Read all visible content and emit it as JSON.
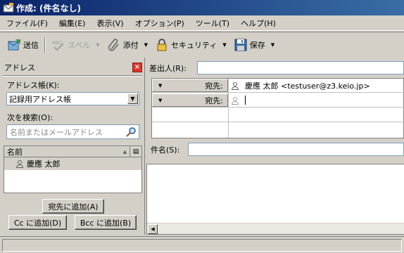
{
  "window": {
    "title": "作成: (件名なし)"
  },
  "menu": [
    "ファイル(F)",
    "編集(E)",
    "表示(V)",
    "オプション(P)",
    "ツール(T)",
    "ヘルプ(H)"
  ],
  "toolbar": {
    "send": "送信",
    "spell": "スペル",
    "attach": "添付",
    "security": "セキュリティ",
    "save": "保存"
  },
  "sidebar": {
    "title": "アドレス",
    "addressbook_label": "アドレス帳(K):",
    "addressbook_value": "記録用アドレス帳",
    "search_label": "次を検索(O):",
    "search_placeholder": "名前またはメールアドレス",
    "column_name": "名前",
    "contacts": [
      "慶應 太郎"
    ],
    "add_to_button": "宛先に追加(A)",
    "add_cc_button": "Cc に追加(D)",
    "add_bcc_button": "Bcc に追加(B)"
  },
  "compose": {
    "from_label": "差出人(R):",
    "from_value": "",
    "recipients": [
      {
        "type": "宛先:",
        "value": "慶應 太郎 <testuser@z3.keio.jp>"
      },
      {
        "type": "宛先:",
        "value": ""
      }
    ],
    "subject_label": "件名(S):",
    "subject_value": ""
  },
  "colors": {
    "titlebar_start": "#0a246a",
    "titlebar_end": "#3a6ea5",
    "chrome": "#d4d0c8"
  }
}
